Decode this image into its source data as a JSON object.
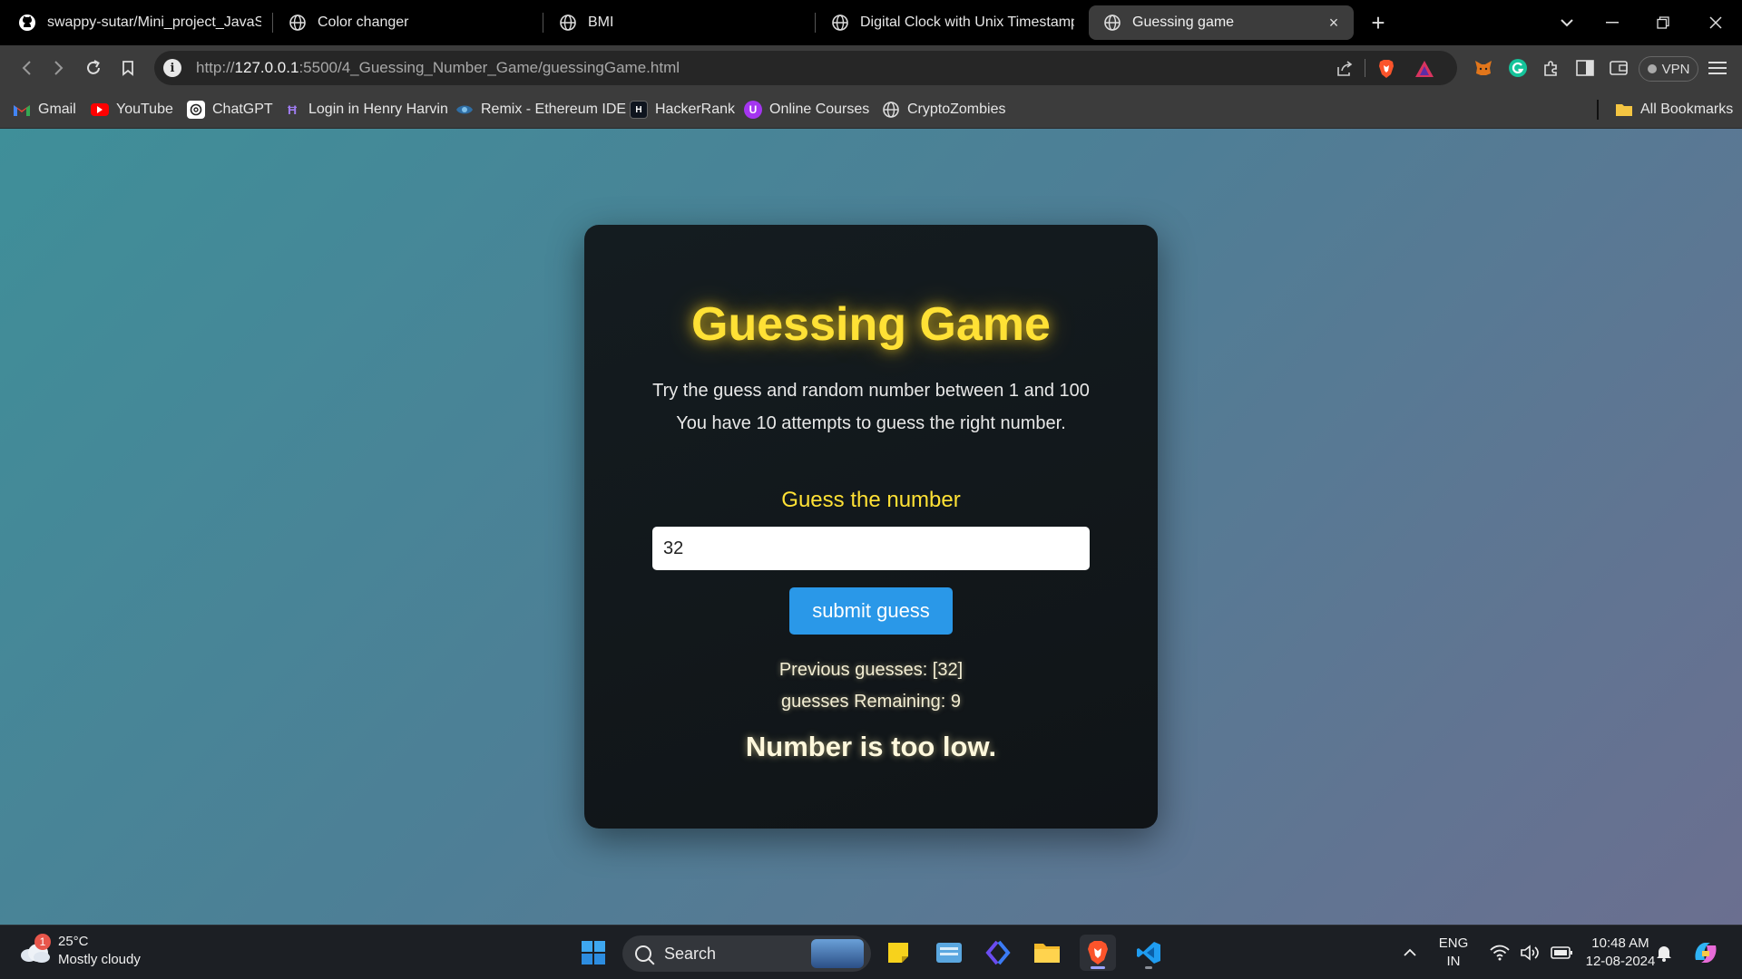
{
  "browser": {
    "tabs": [
      {
        "title": "swappy-sutar/Mini_project_JavaScri",
        "icon": "github-icon",
        "active": false
      },
      {
        "title": "Color changer",
        "icon": "globe-icon",
        "active": false
      },
      {
        "title": "BMI",
        "icon": "globe-icon",
        "active": false
      },
      {
        "title": "Digital Clock with Unix Timestamp",
        "icon": "globe-icon",
        "active": false
      },
      {
        "title": "Guessing game",
        "icon": "globe-icon",
        "active": true
      }
    ],
    "new_tab_symbol": "+",
    "close_symbol": "×",
    "address": {
      "scheme": "http://",
      "host": "127.0.0.1",
      "path": ":5500/4_Guessing_Number_Game/guessingGame.html"
    },
    "vpn_label": "VPN",
    "bookmarks": [
      {
        "label": "Gmail",
        "icon": "gmail-icon"
      },
      {
        "label": "YouTube",
        "icon": "youtube-icon"
      },
      {
        "label": "ChatGPT",
        "icon": "chatgpt-icon"
      },
      {
        "label": "Login in Henry Harvin",
        "icon": "henry-harvin-icon"
      },
      {
        "label": "Remix - Ethereum IDE",
        "icon": "remix-icon"
      },
      {
        "label": "HackerRank",
        "icon": "hackerrank-icon"
      },
      {
        "label": "Online Courses",
        "icon": "udemy-icon"
      },
      {
        "label": "CryptoZombies",
        "icon": "globe-icon"
      }
    ],
    "all_bookmarks_label": "All Bookmarks"
  },
  "game": {
    "title": "Guessing Game",
    "description_line1": "Try the guess and random number between 1 and 100",
    "description_line2": "You have 10 attempts to guess the right number.",
    "guess_label": "Guess the number",
    "input_value": "32",
    "submit_label": "submit guess",
    "previous_guesses": "Previous guesses: [32]",
    "remaining": "guesses Remaining: 9",
    "result": "Number is too low."
  },
  "taskbar": {
    "weather_temp": "25°C",
    "weather_desc": "Mostly cloudy",
    "weather_badge": "1",
    "search_label": "Search",
    "lang_line1": "ENG",
    "lang_line2": "IN",
    "time": "10:48 AM",
    "date": "12-08-2024"
  },
  "colors": {
    "title_yellow": "#ffe135",
    "button_blue": "#2a98e8",
    "card_bg": "#121a1d",
    "tab_active": "#3c3c3c"
  }
}
